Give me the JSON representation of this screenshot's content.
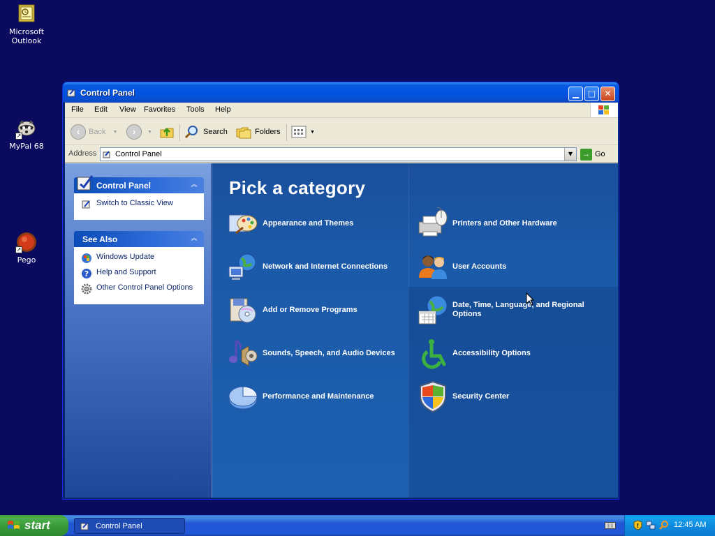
{
  "desktop": {
    "icons": [
      {
        "label": "Microsoft Outlook",
        "icon": "outlook-icon"
      },
      {
        "label": "MyPal 68",
        "icon": "raccoon-icon"
      },
      {
        "label": "Pego",
        "icon": "pego-icon"
      }
    ]
  },
  "window": {
    "title": "Control Panel",
    "menu": [
      "File",
      "Edit",
      "View",
      "Favorites",
      "Tools",
      "Help"
    ],
    "toolbar": {
      "back_label": "Back",
      "search_label": "Search",
      "folders_label": "Folders"
    },
    "address": {
      "label": "Address",
      "value": "Control Panel",
      "go_label": "Go"
    },
    "left_pane": {
      "control_panel": {
        "title": "Control Panel",
        "links": [
          {
            "label": "Switch to Classic View",
            "icon": "classic-view-icon"
          }
        ]
      },
      "see_also": {
        "title": "See Also",
        "links": [
          {
            "label": "Windows Update",
            "icon": "windows-update-icon"
          },
          {
            "label": "Help and Support",
            "icon": "help-icon"
          },
          {
            "label": "Other Control Panel Options",
            "icon": "gear-icon"
          }
        ]
      }
    },
    "main": {
      "heading": "Pick a category",
      "categories_left": [
        {
          "label": "Appearance and Themes",
          "icon": "appearance-icon"
        },
        {
          "label": "Network and Internet Connections",
          "icon": "network-icon"
        },
        {
          "label": "Add or Remove Programs",
          "icon": "add-remove-icon"
        },
        {
          "label": "Sounds, Speech, and Audio Devices",
          "icon": "sound-icon"
        },
        {
          "label": "Performance and Maintenance",
          "icon": "performance-icon"
        }
      ],
      "categories_right": [
        {
          "label": "Printers and Other Hardware",
          "icon": "printer-icon"
        },
        {
          "label": "User Accounts",
          "icon": "users-icon"
        },
        {
          "label": "Date, Time, Language, and Regional Options",
          "icon": "globe-calendar-icon"
        },
        {
          "label": "Accessibility Options",
          "icon": "accessibility-icon"
        },
        {
          "label": "Security Center",
          "icon": "shield-icon"
        }
      ]
    }
  },
  "taskbar": {
    "start_label": "start",
    "tasks": [
      {
        "label": "Control Panel"
      }
    ],
    "clock": "12:45 AM"
  },
  "colors": {
    "desktop": "#0a0a5e",
    "titlebar": "#0054e3",
    "category_pane": "#1b5aa8",
    "start_button": "#3a9a3a",
    "tray": "#0f8be0"
  }
}
